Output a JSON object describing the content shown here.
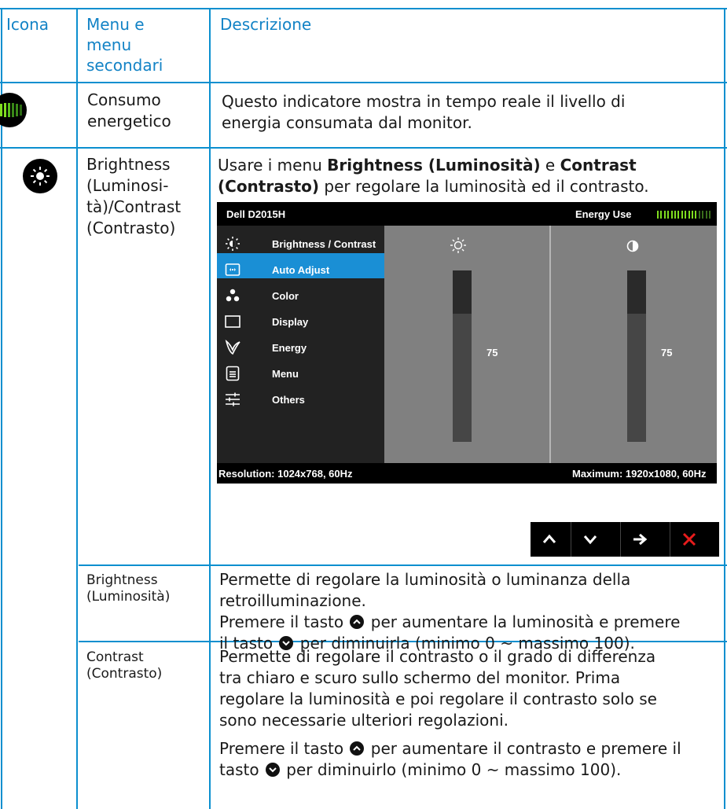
{
  "table": {
    "headers": {
      "icon": "Icona",
      "menu": "Menu e menu secondari",
      "desc": "Descrizione"
    },
    "header_lines": [
      "Menu e",
      "menu",
      "secondari"
    ]
  },
  "rows": {
    "energy": {
      "menu_lines": [
        "Consumo",
        "energetico"
      ],
      "desc_lines": [
        "Questo indicatore mostra in tempo reale il livello di",
        "energia consumata dal monitor."
      ]
    },
    "brightness_contrast": {
      "menu_lines": [
        "Brightness",
        "(Luminosi-",
        "tà)/Contrast",
        "(Contrasto)"
      ],
      "desc_line1_pre": "Usare i menu ",
      "desc_line1_b1": "Brightness (Luminosità)",
      "desc_line1_mid": " e ",
      "desc_line1_b2": "Contrast",
      "desc_line2_b": "(Contrasto)",
      "desc_line2_post": " per regolare la luminosità ed il contrasto."
    },
    "brightness": {
      "menu_lines": [
        "Brightness",
        "(Luminosità)"
      ],
      "desc_l1": "Permette di regolare la luminosità o luminanza della",
      "desc_l2": "retroilluminazione.",
      "desc_l3_pre": "Premere il tasto ",
      "desc_l3_post": " per aumentare la luminosità e premere",
      "desc_l4_pre": "il tasto ",
      "desc_l4_post": " per diminuirla (minimo 0 ~ massimo 100)."
    },
    "contrast": {
      "menu_lines": [
        "Contrast",
        "(Contrasto)"
      ],
      "desc_l1": "Permette di regolare il contrasto o il grado di differenza",
      "desc_l2": "tra chiaro e scuro sullo schermo del monitor. Prima",
      "desc_l3": "regolare la luminosità e poi regolare il contrasto solo se",
      "desc_l4": "sono necessarie ulteriori regolazioni.",
      "desc_l5_pre": "Premere il tasto ",
      "desc_l5_post": " per aumentare il contrasto e premere il",
      "desc_l6_pre": "tasto ",
      "desc_l6_post": " per diminuirlo (minimo 0 ~ massimo 100)."
    }
  },
  "osd": {
    "model": "Dell D2015H",
    "energy_label": "Energy Use",
    "menu_items": [
      {
        "label": "Brightness / Contrast",
        "icon": "brightness-icon",
        "selected": true
      },
      {
        "label": "Auto Adjust",
        "icon": "auto-adjust-icon"
      },
      {
        "label": "Color",
        "icon": "color-icon"
      },
      {
        "label": "Display",
        "icon": "display-icon"
      },
      {
        "label": "Energy",
        "icon": "energy-leaf-icon"
      },
      {
        "label": "Menu",
        "icon": "menu-icon"
      },
      {
        "label": "Others",
        "icon": "others-sliders-icon"
      }
    ],
    "brightness_value": "75",
    "contrast_value": "75",
    "brightness_level": 0.75,
    "contrast_level": 0.75,
    "resolution": "Resolution: 1024x768, 60Hz",
    "maximum": "Maximum: 1920x1080, 60Hz"
  },
  "nav_buttons": [
    "up-arrow-icon",
    "down-arrow-icon",
    "right-arrow-icon",
    "close-x-icon"
  ],
  "colors": {
    "accent": "#1383c6",
    "rule": "#0b8fcf",
    "osd_select": "#1a8fd5",
    "close_red": "#e81c1c"
  }
}
